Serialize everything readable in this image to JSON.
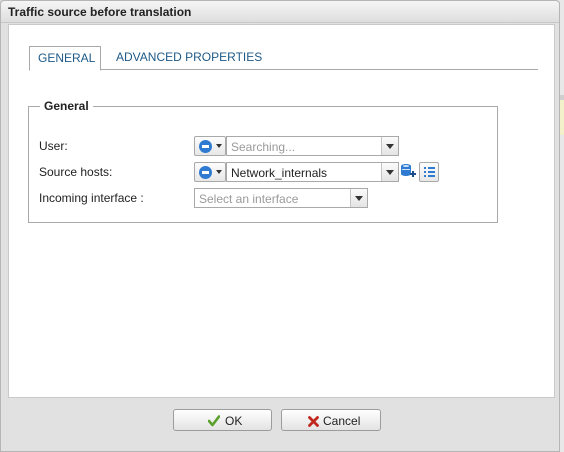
{
  "dialog": {
    "title": "Traffic source before translation"
  },
  "tabs": [
    {
      "label": "GENERAL",
      "active": true
    },
    {
      "label": "ADVANCED PROPERTIES",
      "active": false
    }
  ],
  "general": {
    "legend": "General",
    "user": {
      "label": "User:",
      "placeholder": "Searching..."
    },
    "source_hosts": {
      "label": "Source hosts:",
      "value": "Network_internals"
    },
    "incoming_interface": {
      "label": "Incoming interface :",
      "placeholder": "Select an interface"
    }
  },
  "footer": {
    "ok_label": "OK",
    "cancel_label": "Cancel"
  },
  "colors": {
    "accent": "#2f7bd1",
    "tab_text": "#1e5a87",
    "ok_check": "#5aa02c",
    "cancel_x": "#c0281e"
  },
  "icons": {
    "object_type": "circle-minus-icon",
    "add_object": "database-add-icon",
    "list": "list-icon",
    "ok": "checkmark-icon",
    "cancel": "x-icon"
  }
}
